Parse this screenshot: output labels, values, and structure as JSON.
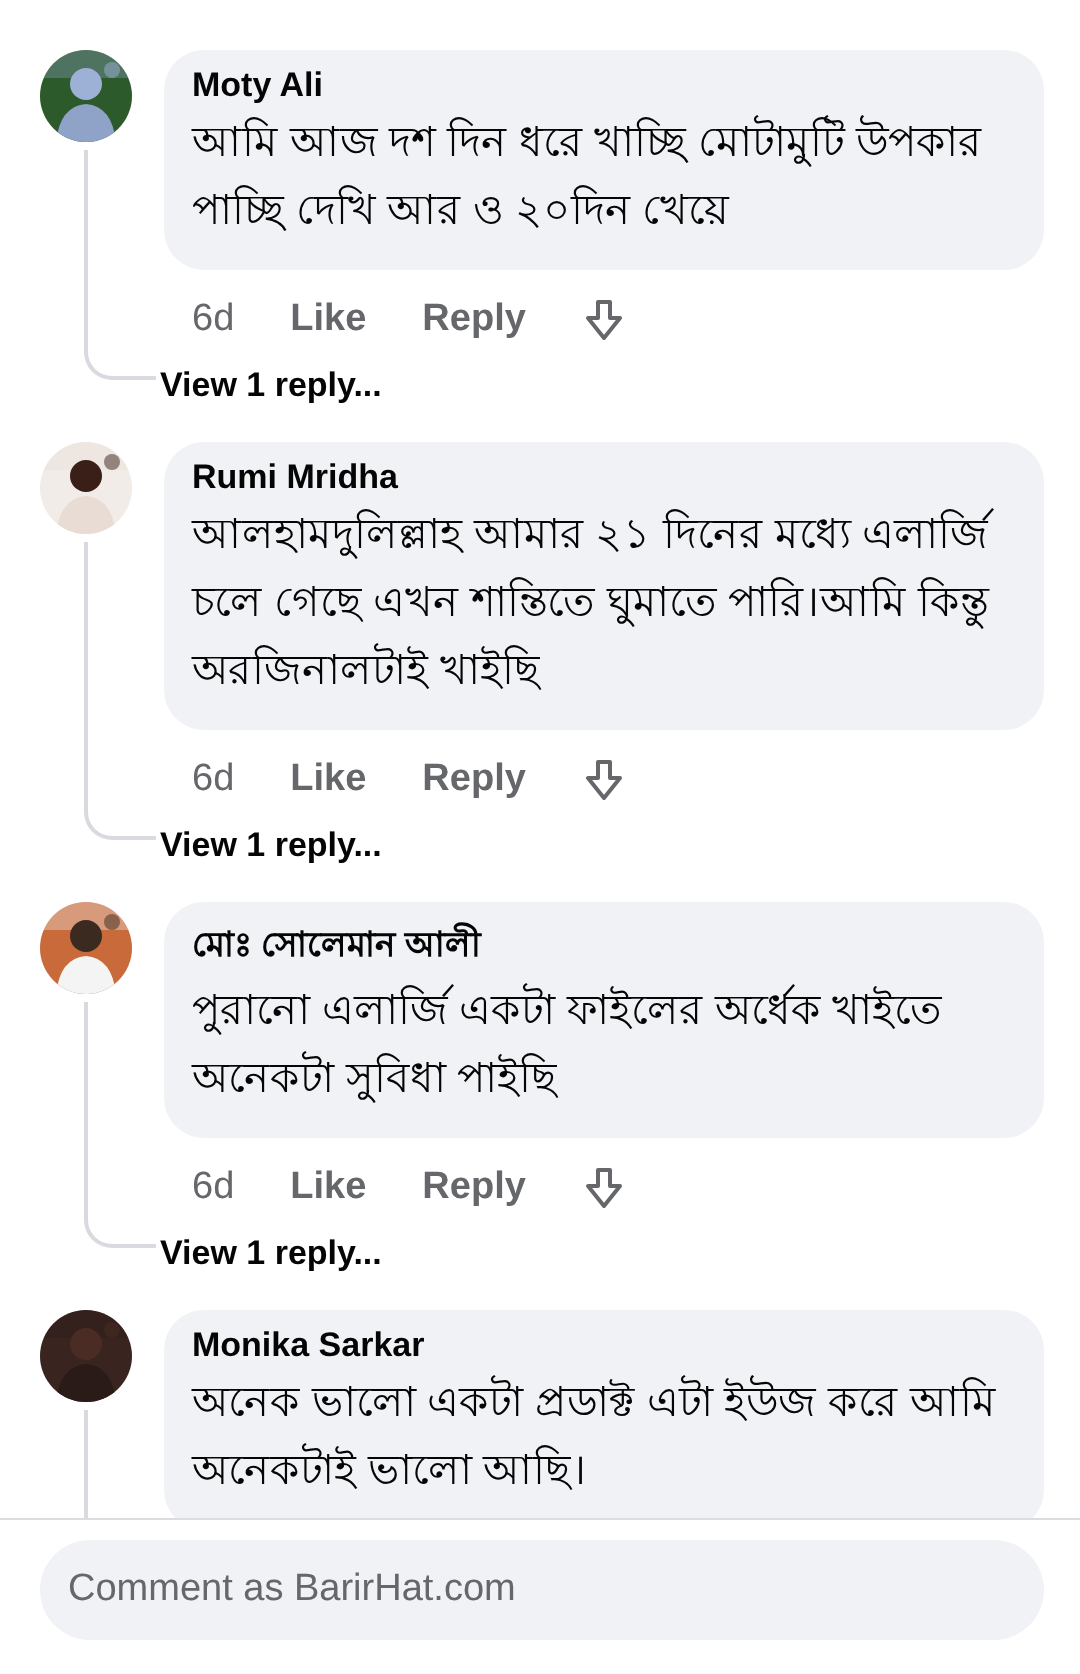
{
  "comments": [
    {
      "author": "Moty Ali",
      "text": "আমি আজ দশ দিন ধরে খাচ্ছি মোটামুটি উপকার পাচ্ছি দেখি আর ও ২০দিন খেয়ে",
      "meta": {
        "time": "6d",
        "like": "Like",
        "reply": "Reply"
      },
      "view_replies": "View 1 reply..."
    },
    {
      "author": "Rumi Mridha",
      "text": "আলহামদুলিল্লাহ আমার ২১ দিনের মধ্যে এলার্জি চলে গেছে এখন শান্তিতে ঘুমাতে পারি।আমি কিন্তু অরজিনালটাই খাইছি",
      "meta": {
        "time": "6d",
        "like": "Like",
        "reply": "Reply"
      },
      "view_replies": "View 1 reply..."
    },
    {
      "author": "মোঃ সোলেমান আলী",
      "text": "পুরানো এলার্জি একটা ফাইলের অর্ধেক খাইতে অনেকটা সুবিধা পাইছি",
      "meta": {
        "time": "6d",
        "like": "Like",
        "reply": "Reply"
      },
      "view_replies": "View 1 reply..."
    },
    {
      "author": "Monika Sarkar",
      "text": "অনেক ভালো একটা প্রডাক্ট এটা ইউজ করে আমি অনেকটাই ভালো আছি।"
    }
  ],
  "composer": {
    "placeholder": "Comment as BarirHat.com"
  }
}
